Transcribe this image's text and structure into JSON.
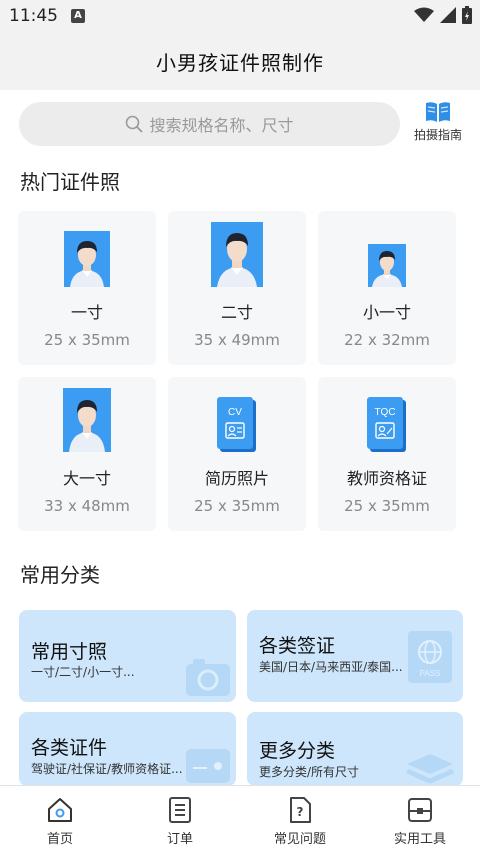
{
  "status_bar": {
    "time": "11:45",
    "notification_letter": "A"
  },
  "header": {
    "title": "小男孩证件照制作"
  },
  "search": {
    "placeholder": "搜索规格名称、尺寸"
  },
  "guide": {
    "label": "拍摄指南",
    "icon": "open-book-icon"
  },
  "popular": {
    "title": "热门证件照",
    "items": [
      {
        "name": "一寸",
        "size": "25 x 35mm"
      },
      {
        "name": "二寸",
        "size": "35 x 49mm"
      },
      {
        "name": "小一寸",
        "size": "22 x 32mm"
      },
      {
        "name": "大一寸",
        "size": "33 x 48mm"
      },
      {
        "name": "简历照片",
        "size": "25 x 35mm",
        "badge": "CV"
      },
      {
        "name": "教师资格证",
        "size": "25 x 35mm",
        "badge": "TQC"
      }
    ]
  },
  "categories": {
    "title": "常用分类",
    "items": [
      {
        "title": "常用寸照",
        "subtitle": "一寸/二寸/小一寸...",
        "icon": "camera-icon"
      },
      {
        "title": "各类签证",
        "subtitle": "美国/日本/马来西亚/泰国...",
        "icon": "passport-icon",
        "badge": "PASS"
      },
      {
        "title": "各类证件",
        "subtitle": "驾驶证/社保证/教师资格证...",
        "icon": "id-card-icon"
      },
      {
        "title": "更多分类",
        "subtitle": "更多分类/所有尺寸",
        "icon": "layers-icon"
      }
    ]
  },
  "tabs": [
    {
      "label": "首页",
      "icon": "home-icon",
      "active": true
    },
    {
      "label": "订单",
      "icon": "order-list-icon",
      "active": false
    },
    {
      "label": "常见问题",
      "icon": "question-doc-icon",
      "active": false
    },
    {
      "label": "实用工具",
      "icon": "toolbox-icon",
      "active": false
    }
  ],
  "colors": {
    "accent": "#3c9cf2",
    "card_bg": "#cde6fb",
    "header_bg": "#f2f2f2"
  }
}
